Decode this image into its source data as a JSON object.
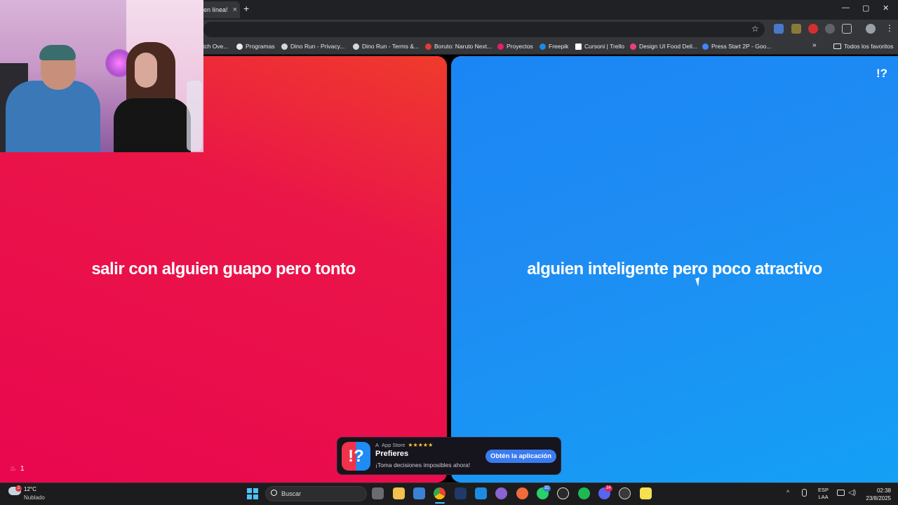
{
  "browser": {
    "tab_title": "en línea!",
    "tab_close": "×",
    "new_tab": "+",
    "window_controls": [
      "—",
      "▢",
      "✕"
    ],
    "bookmarks": [
      {
        "label": "tch Ove...",
        "color": "#9146ff"
      },
      {
        "label": "Programas",
        "color": "#e8eaed"
      },
      {
        "label": "Dino Run - Privacy...",
        "color": "#cfd8dc"
      },
      {
        "label": "Dino Run - Terms &...",
        "color": "#cfd8dc"
      },
      {
        "label": "Boruto: Naruto Next...",
        "color": "#e53935"
      },
      {
        "label": "Proyectos",
        "color": "#e91e63"
      },
      {
        "label": "Freepik",
        "color": "#1e88e5"
      },
      {
        "label": "Cursoni | Trello",
        "color": "#ffffff"
      },
      {
        "label": "Design UI Food Deli...",
        "color": "#ec407a"
      },
      {
        "label": "Press Start 2P - Goo...",
        "color": "#4285f4"
      }
    ],
    "bookmarks_overflow": "»",
    "all_bookmarks": "Todos los favoritos"
  },
  "game": {
    "logo": "!?",
    "option_left": "salir con alguien guapo pero tonto",
    "option_right": "alguien inteligente pero poco atractivo",
    "votes_count": "1",
    "colors": {
      "left": "#ea1548",
      "right": "#1e8cf3"
    }
  },
  "app_banner": {
    "icon_text": "!?",
    "store": "App Store",
    "stars": "★★★★★",
    "name": "Prefieres",
    "tagline": "¡Toma decisiones imposibles ahora!",
    "cta": "Obtén la aplicación"
  },
  "taskbar": {
    "weather_temp": "12°C",
    "weather_desc": "Nublado",
    "weather_badge": "2",
    "search_label": "Buscar",
    "whatsapp_badge": "32",
    "discord_badge": "34",
    "lang_line1": "ESP",
    "lang_line2": "LAA",
    "time": "02:38",
    "date": "23/8/2025"
  }
}
